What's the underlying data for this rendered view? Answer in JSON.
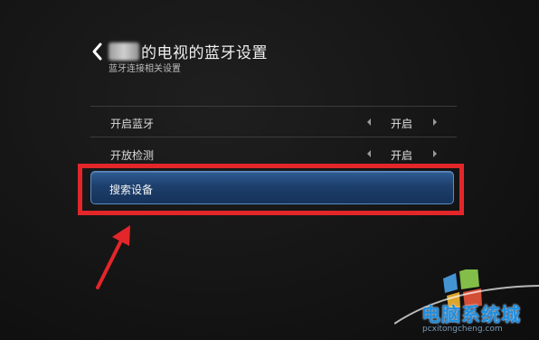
{
  "header": {
    "title": "的电视的蓝牙设置",
    "subtitle": "蓝牙连接相关设置"
  },
  "settings": [
    {
      "label": "开启蓝牙",
      "value": "开启"
    },
    {
      "label": "开放检测",
      "value": "开启"
    }
  ],
  "search_button": {
    "label": "搜索设备"
  },
  "watermark": {
    "title": "电脑系统城",
    "url": "pcxitongcheng.com"
  },
  "colors": {
    "highlight_border": "#e2262a",
    "selected_button": "#1d3f6c",
    "watermark_blue": "#1f8fe0"
  }
}
